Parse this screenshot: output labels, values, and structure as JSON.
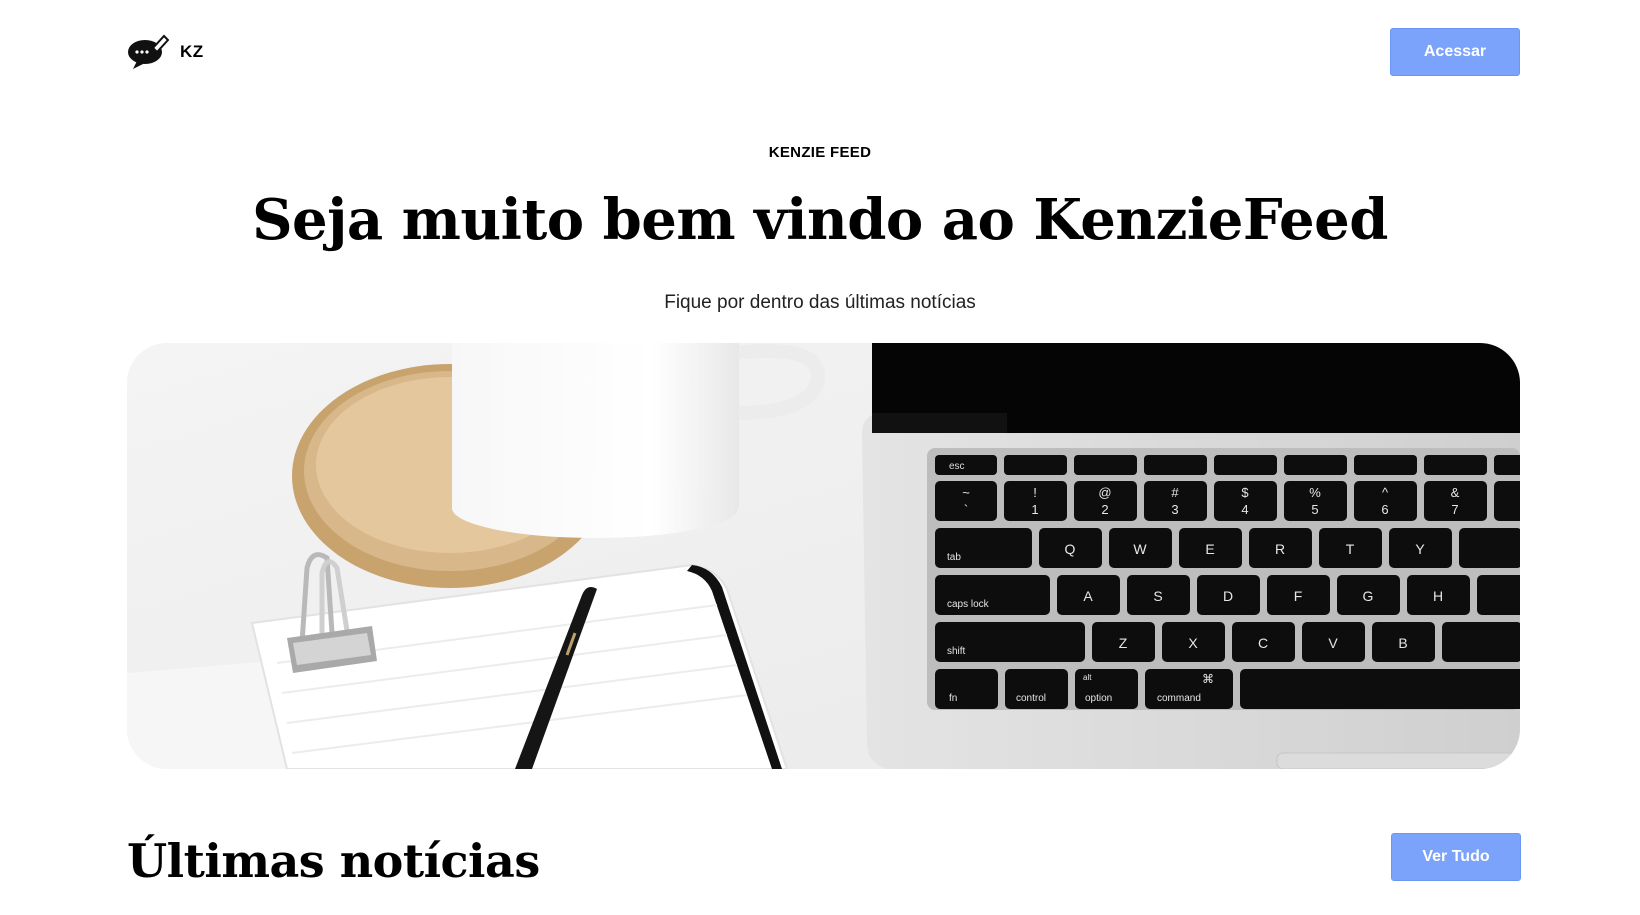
{
  "header": {
    "logo_text": "KZ",
    "logo_icon": "speech-bubble-pen-icon",
    "login_label": "Acessar"
  },
  "hero": {
    "eyebrow": "KENZIE FEED",
    "title": "Seja muito bem vindo ao KenzieFeed",
    "subtitle": "Fique por dentro das últimas notícias",
    "keys": {
      "esc": "esc",
      "tab": "tab",
      "caps": "caps lock",
      "shift": "shift",
      "fn": "fn",
      "control": "control",
      "option": "option",
      "command": "command",
      "alt": "alt",
      "cmd_symbol": "⌘",
      "num_row": [
        "~",
        "!",
        "@",
        "#",
        "$",
        "%",
        "^",
        "&"
      ],
      "num_row_lower": [
        "`",
        "1",
        "2",
        "3",
        "4",
        "5",
        "6",
        "7"
      ],
      "q_row": [
        "Q",
        "W",
        "E",
        "R",
        "T",
        "Y"
      ],
      "a_row": [
        "A",
        "S",
        "D",
        "F",
        "G",
        "H"
      ],
      "z_row": [
        "Z",
        "X",
        "C",
        "V",
        "B"
      ]
    }
  },
  "latest": {
    "title": "Últimas notícias",
    "view_all_label": "Ver Tudo"
  },
  "colors": {
    "accent": "#7ba3fb",
    "text": "#000000",
    "background": "#ffffff"
  }
}
